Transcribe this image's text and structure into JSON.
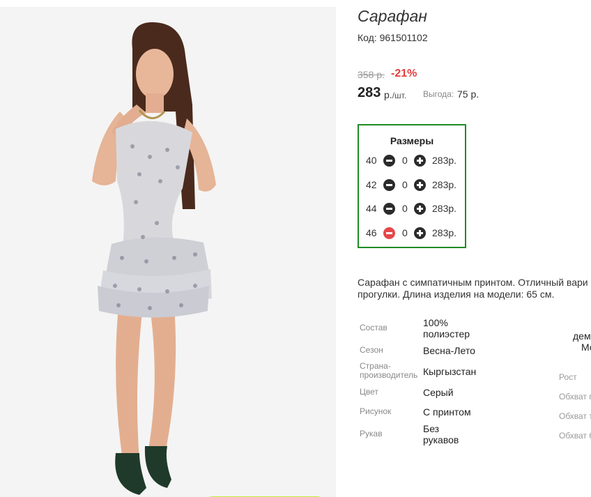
{
  "product": {
    "title": "Сарафан",
    "code_label": "Код:",
    "code_value": "961501102",
    "old_price": "358 р.",
    "discount": "-21%",
    "price": "283",
    "price_unit": "р.",
    "per_unit": "/шт.",
    "benefit_label": "Выгода:",
    "benefit_value": "75 р."
  },
  "sizes": {
    "title": "Размеры",
    "rows": [
      {
        "size": "40",
        "qty": "0",
        "price": "283р.",
        "minus_active": false
      },
      {
        "size": "42",
        "qty": "0",
        "price": "283р.",
        "minus_active": false
      },
      {
        "size": "44",
        "qty": "0",
        "price": "283р.",
        "minus_active": false
      },
      {
        "size": "46",
        "qty": "0",
        "price": "283р.",
        "minus_active": true
      }
    ]
  },
  "description": {
    "line1": "Сарафан с симпатичным принтом. Отличный вари",
    "line2": "прогулки. Длина изделия на модели: 65 см."
  },
  "attributes": [
    {
      "label": "Состав",
      "value1": "100%",
      "value2": "полиэстер"
    },
    {
      "label": "Сезон",
      "value1": "Весна-Лето",
      "value2": ""
    },
    {
      "label": "Страна-",
      "label2": "производитель",
      "value1": "Кыргызстан",
      "value2": ""
    },
    {
      "label": "Цвет",
      "value1": "Серый",
      "value2": ""
    },
    {
      "label": "Рисунок",
      "value1": "С принтом",
      "value2": ""
    },
    {
      "label": "Рукав",
      "value1": "Без",
      "value2": "рукавов"
    }
  ],
  "model_params": {
    "partial_1": "дем",
    "partial_2": "Мо",
    "height_label": "Рост",
    "chest_label": "Обхват г",
    "waist_label": "Обхват т",
    "hips_label": "Обхват б"
  },
  "colors": {
    "accent_green": "#1f8b24",
    "discount_red": "#e2403f",
    "cta_lime": "#c6ec3a",
    "minus_red": "#e5484b"
  }
}
